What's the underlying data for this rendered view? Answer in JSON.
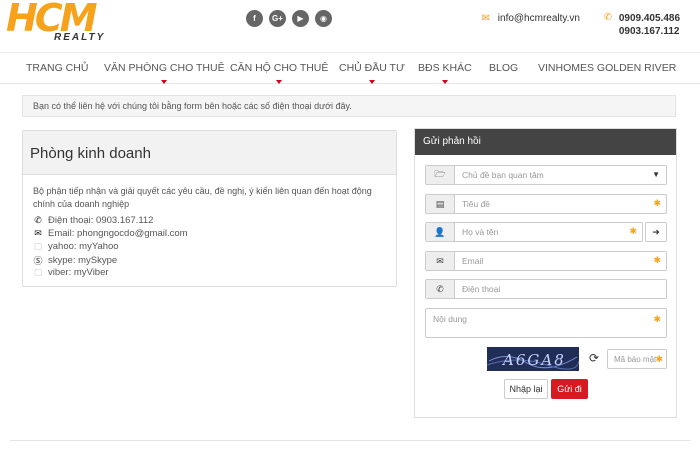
{
  "logo": {
    "main": "HCM",
    "sub": "REALTY"
  },
  "socials": [
    {
      "icon": "facebook-icon",
      "glyph": "f"
    },
    {
      "icon": "google-plus-icon",
      "glyph": "G+"
    },
    {
      "icon": "youtube-icon",
      "glyph": "▶"
    },
    {
      "icon": "rss-icon",
      "glyph": "◉"
    }
  ],
  "contact": {
    "email": "info@hcmrealty.vn",
    "phones": [
      "0909.405.486",
      "0903.167.112"
    ]
  },
  "nav": {
    "items": [
      {
        "label": "TRANG CHỦ",
        "dropdown": false
      },
      {
        "label": "VĂN PHÒNG CHO THUÊ",
        "dropdown": true
      },
      {
        "label": "CĂN HỘ CHO THUÊ",
        "dropdown": true
      },
      {
        "label": "CHỦ ĐẦU TƯ",
        "dropdown": true
      },
      {
        "label": "BĐS KHÁC",
        "dropdown": true
      },
      {
        "label": "BLOG",
        "dropdown": false
      },
      {
        "label": "VINHOMES GOLDEN RIVER",
        "dropdown": false
      }
    ]
  },
  "notice": "Bạn có thể liên hệ với chúng tôi bằng form bên hoặc các số điện thoại dưới đây.",
  "department": {
    "title": "Phòng kinh doanh",
    "description": "Bộ phận tiếp nhận và giải quyết các yêu cầu, đề nghị, ý kiến liên quan đến hoạt động chính của doanh nghiệp",
    "rows": [
      {
        "icon": "phone-icon",
        "text": "Điện thoại: 0903.167.112"
      },
      {
        "icon": "envelope-icon",
        "text": "Email: phongngocdo@gmail.com"
      },
      {
        "icon": "yahoo-icon",
        "text": "yahoo: myYahoo"
      },
      {
        "icon": "skype-icon",
        "text": "skype: mySkype"
      },
      {
        "icon": "viber-icon",
        "text": "viber: myViber"
      }
    ]
  },
  "form": {
    "title": "Gửi phản hồi",
    "topic_placeholder": "Chủ đề bạn quan tâm",
    "subject_placeholder": "Tiêu đề",
    "name_placeholder": "Họ và tên",
    "email_placeholder": "Email",
    "phone_placeholder": "Điện thoại",
    "content_placeholder": "Nội dung",
    "captcha_placeholder": "Mã bảo mật",
    "captcha_text": "A6GA8",
    "reset_label": "Nhập lại",
    "submit_label": "Gửi đi"
  },
  "colors": {
    "accent": "#f7a21b",
    "danger": "#d71920",
    "panel_head": "#444444"
  }
}
